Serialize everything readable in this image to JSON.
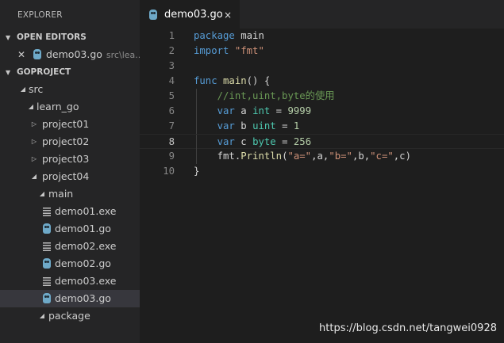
{
  "sidebar": {
    "title": "EXPLORER",
    "open_editors": {
      "header": "OPEN EDITORS",
      "items": [
        {
          "name": "demo03.go",
          "path": "src\\lea..."
        }
      ]
    },
    "project": {
      "header": "GOPROJECT",
      "tree": [
        {
          "label": "src"
        },
        {
          "label": "learn_go"
        },
        {
          "label": "project01"
        },
        {
          "label": "project02"
        },
        {
          "label": "project03"
        },
        {
          "label": "project04"
        },
        {
          "label": "main"
        },
        {
          "label": "demo01.exe"
        },
        {
          "label": "demo01.go"
        },
        {
          "label": "demo02.exe"
        },
        {
          "label": "demo02.go"
        },
        {
          "label": "demo03.exe"
        },
        {
          "label": "demo03.go"
        },
        {
          "label": "package"
        }
      ]
    }
  },
  "editor": {
    "tab": {
      "label": "demo03.go",
      "close": "×"
    },
    "lines": [
      {
        "num": "1",
        "tokens": [
          [
            "k",
            "package"
          ],
          [
            "p",
            " main"
          ]
        ]
      },
      {
        "num": "2",
        "tokens": [
          [
            "k",
            "import"
          ],
          [
            "p",
            " "
          ],
          [
            "s",
            "\"fmt\""
          ]
        ]
      },
      {
        "num": "3",
        "tokens": []
      },
      {
        "num": "4",
        "tokens": [
          [
            "k",
            "func"
          ],
          [
            "p",
            " "
          ],
          [
            "f",
            "main"
          ],
          [
            "p",
            "() {"
          ]
        ]
      },
      {
        "num": "5",
        "tokens": [
          [
            "p",
            "    "
          ],
          [
            "c",
            "//int,uint,byte的使用"
          ]
        ]
      },
      {
        "num": "6",
        "tokens": [
          [
            "p",
            "    "
          ],
          [
            "k",
            "var"
          ],
          [
            "p",
            " a "
          ],
          [
            "t",
            "int"
          ],
          [
            "p",
            " = "
          ],
          [
            "n",
            "9999"
          ]
        ]
      },
      {
        "num": "7",
        "tokens": [
          [
            "p",
            "    "
          ],
          [
            "k",
            "var"
          ],
          [
            "p",
            " b "
          ],
          [
            "t",
            "uint"
          ],
          [
            "p",
            " = "
          ],
          [
            "n",
            "1"
          ]
        ]
      },
      {
        "num": "8",
        "tokens": [
          [
            "p",
            "    "
          ],
          [
            "k",
            "var"
          ],
          [
            "p",
            " c "
          ],
          [
            "t",
            "byte"
          ],
          [
            "p",
            " = "
          ],
          [
            "n",
            "256"
          ]
        ]
      },
      {
        "num": "9",
        "tokens": [
          [
            "p",
            "    fmt."
          ],
          [
            "f",
            "Println"
          ],
          [
            "p",
            "("
          ],
          [
            "s",
            "\"a=\""
          ],
          [
            "p",
            ",a,"
          ],
          [
            "s",
            "\"b=\""
          ],
          [
            "p",
            ",b,"
          ],
          [
            "s",
            "\"c=\""
          ],
          [
            "p",
            ",c)"
          ]
        ]
      },
      {
        "num": "10",
        "tokens": [
          [
            "p",
            "}"
          ]
        ]
      }
    ]
  },
  "watermark": "https://blog.csdn.net/tangwei0928"
}
